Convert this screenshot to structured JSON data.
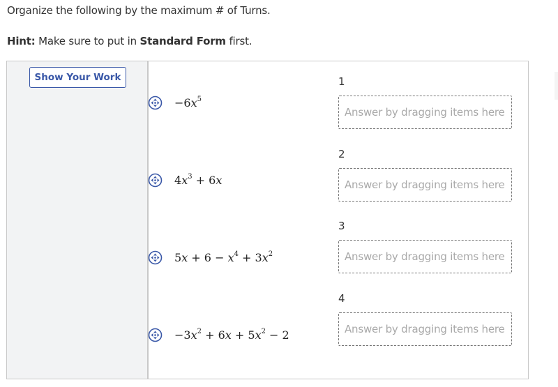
{
  "question": {
    "prompt": "Organize the following by the maximum # of Turns.",
    "hint_label": "Hint:",
    "hint_text_1": " Make sure to put in ",
    "hint_bold": "Standard Form",
    "hint_text_2": " first."
  },
  "show_your_work_button": "Show Your Work",
  "draggable_items": [
    {
      "icon": "drag-move-icon",
      "expression": "−6x^5"
    },
    {
      "icon": "drag-move-icon",
      "expression": "4x^3 + 6x"
    },
    {
      "icon": "drag-move-icon",
      "expression": "5x + 6 − x^4 + 3x^2"
    },
    {
      "icon": "drag-move-icon",
      "expression": "−3x^2 + 6x + 5x^2 − 2"
    }
  ],
  "drop_slots": [
    {
      "label": "1",
      "placeholder": "Answer by dragging items here"
    },
    {
      "label": "2",
      "placeholder": "Answer by dragging items here"
    },
    {
      "label": "3",
      "placeholder": "Answer by dragging items here"
    },
    {
      "label": "4",
      "placeholder": "Answer by dragging items here"
    }
  ],
  "colors": {
    "accent": "#3a58a8",
    "panel_bg": "#f2f3f4",
    "border": "#c8c8c8",
    "placeholder": "#a9a9a9"
  }
}
